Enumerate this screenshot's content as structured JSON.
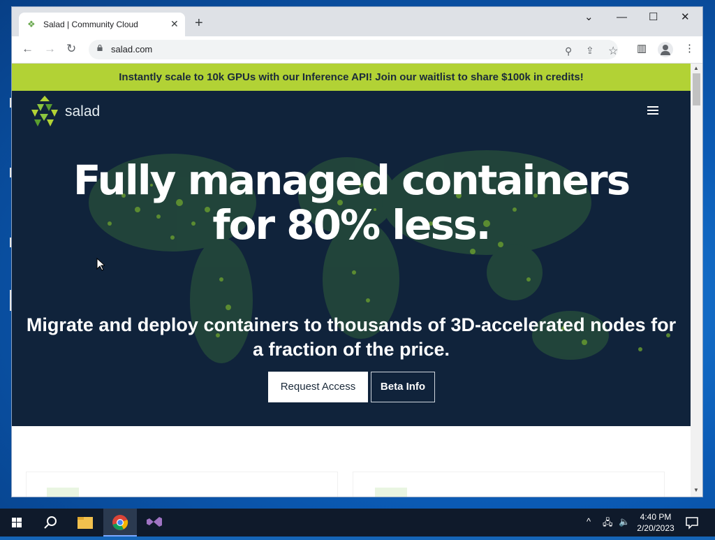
{
  "browser": {
    "tab_title": "Salad | Community Cloud",
    "tab_close": "✕",
    "new_tab": "+",
    "url": "salad.com",
    "window_controls": {
      "dropdown": "⌄",
      "minimize": "—",
      "maximize": "☐",
      "close": "✕"
    }
  },
  "page": {
    "banner": "Instantly scale to 10k GPUs with our Inference API! Join our waitlist to share $100k in credits!",
    "logo_text": "salad",
    "headline_line1": "Fully managed containers",
    "headline_line2": "for 80% less.",
    "subhead": "Migrate and deploy containers to thousands of 3D-accelerated nodes for a fraction of the price.",
    "cta_primary": "Request Access",
    "cta_secondary": "Beta Info"
  },
  "taskbar": {
    "time": "4:40 PM",
    "date": "2/20/2023"
  },
  "colors": {
    "banner_bg": "#b2d235",
    "hero_bg": "#10233b",
    "map_green": "#6a9e2f"
  }
}
